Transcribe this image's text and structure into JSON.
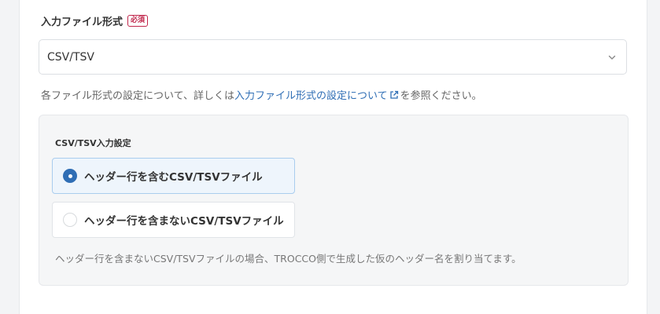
{
  "field": {
    "label": "入力ファイル形式",
    "required_badge": "必須"
  },
  "select": {
    "value": "CSV/TSV",
    "icon": "chevron-down-icon"
  },
  "help": {
    "prefix": "各ファイル形式の設定について、詳しくは",
    "link_text": "入力ファイル形式の設定について",
    "link_icon": "external-link-icon",
    "suffix": "を参照ください。"
  },
  "panel": {
    "title": "CSV/TSV入力設定",
    "options": [
      {
        "label": "ヘッダー行を含むCSV/TSVファイル",
        "selected": true
      },
      {
        "label": "ヘッダー行を含まないCSV/TSVファイル",
        "selected": false
      }
    ],
    "note": "ヘッダー行を含まないCSV/TSVファイルの場合、TROCCO側で生成した仮のヘッダー名を割り当てます。"
  },
  "colors": {
    "accent": "#2f6eb5",
    "required": "#c0264b",
    "link": "#2f6eb5"
  }
}
